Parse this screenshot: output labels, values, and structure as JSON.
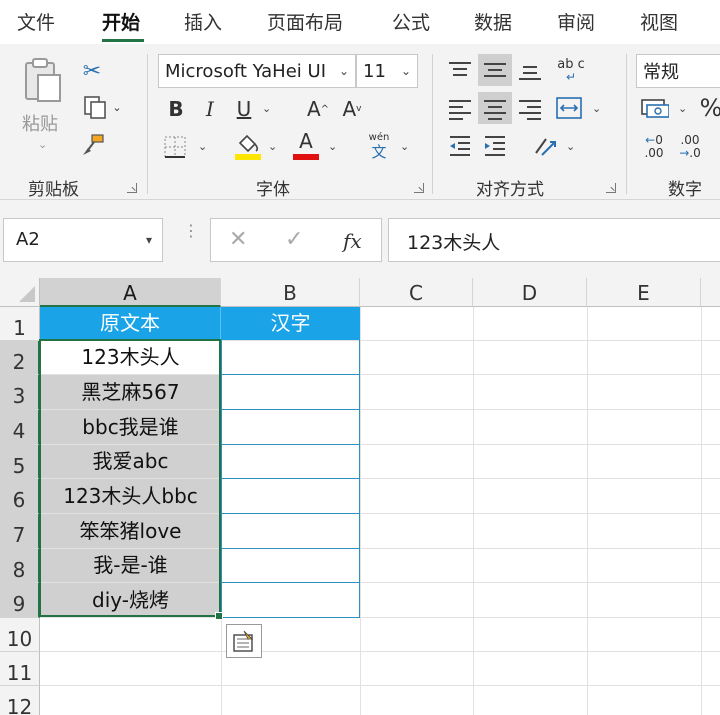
{
  "tabs": [
    "文件",
    "开始",
    "插入",
    "页面布局",
    "公式",
    "数据",
    "审阅",
    "视图"
  ],
  "ribbon": {
    "clipboard": {
      "group_label": "剪贴板",
      "paste_label": "粘贴"
    },
    "font": {
      "group_label": "字体",
      "font_name": "Microsoft YaHei UI",
      "font_size": "11",
      "bold": "B",
      "italic": "I",
      "underline": "U",
      "grow": "A",
      "shrink": "A",
      "font_color_glyph": "A",
      "phonetic_top": "wén",
      "phonetic_bottom": "文",
      "colors": {
        "highlight": "#ffe600",
        "font": "#e01010"
      }
    },
    "alignment": {
      "group_label": "对齐方式",
      "wrap_glyph": "ab c"
    },
    "number": {
      "group_label": "数字",
      "format": "常规",
      "percent": "%"
    }
  },
  "formula_bar": {
    "name_box": "A2",
    "cancel": "✕",
    "enter": "✓",
    "fx": "fx",
    "formula": "123木头人"
  },
  "grid": {
    "columns": [
      "A",
      "B",
      "C",
      "D",
      "E"
    ],
    "rows": [
      "1",
      "2",
      "3",
      "4",
      "5",
      "6",
      "7",
      "8",
      "9",
      "10",
      "11",
      "12"
    ],
    "header_row": {
      "A": "原文本",
      "B": "汉字"
    },
    "column_a_values": [
      "123木头人",
      "黑芝麻567",
      "bbc我是谁",
      "我爱abc",
      "123木头人bbc",
      "笨笨猪love",
      "我-是-谁",
      "diy-烧烤"
    ],
    "accent_colors": {
      "header_fill": "#1aa3e6",
      "selection": "#217346"
    }
  }
}
